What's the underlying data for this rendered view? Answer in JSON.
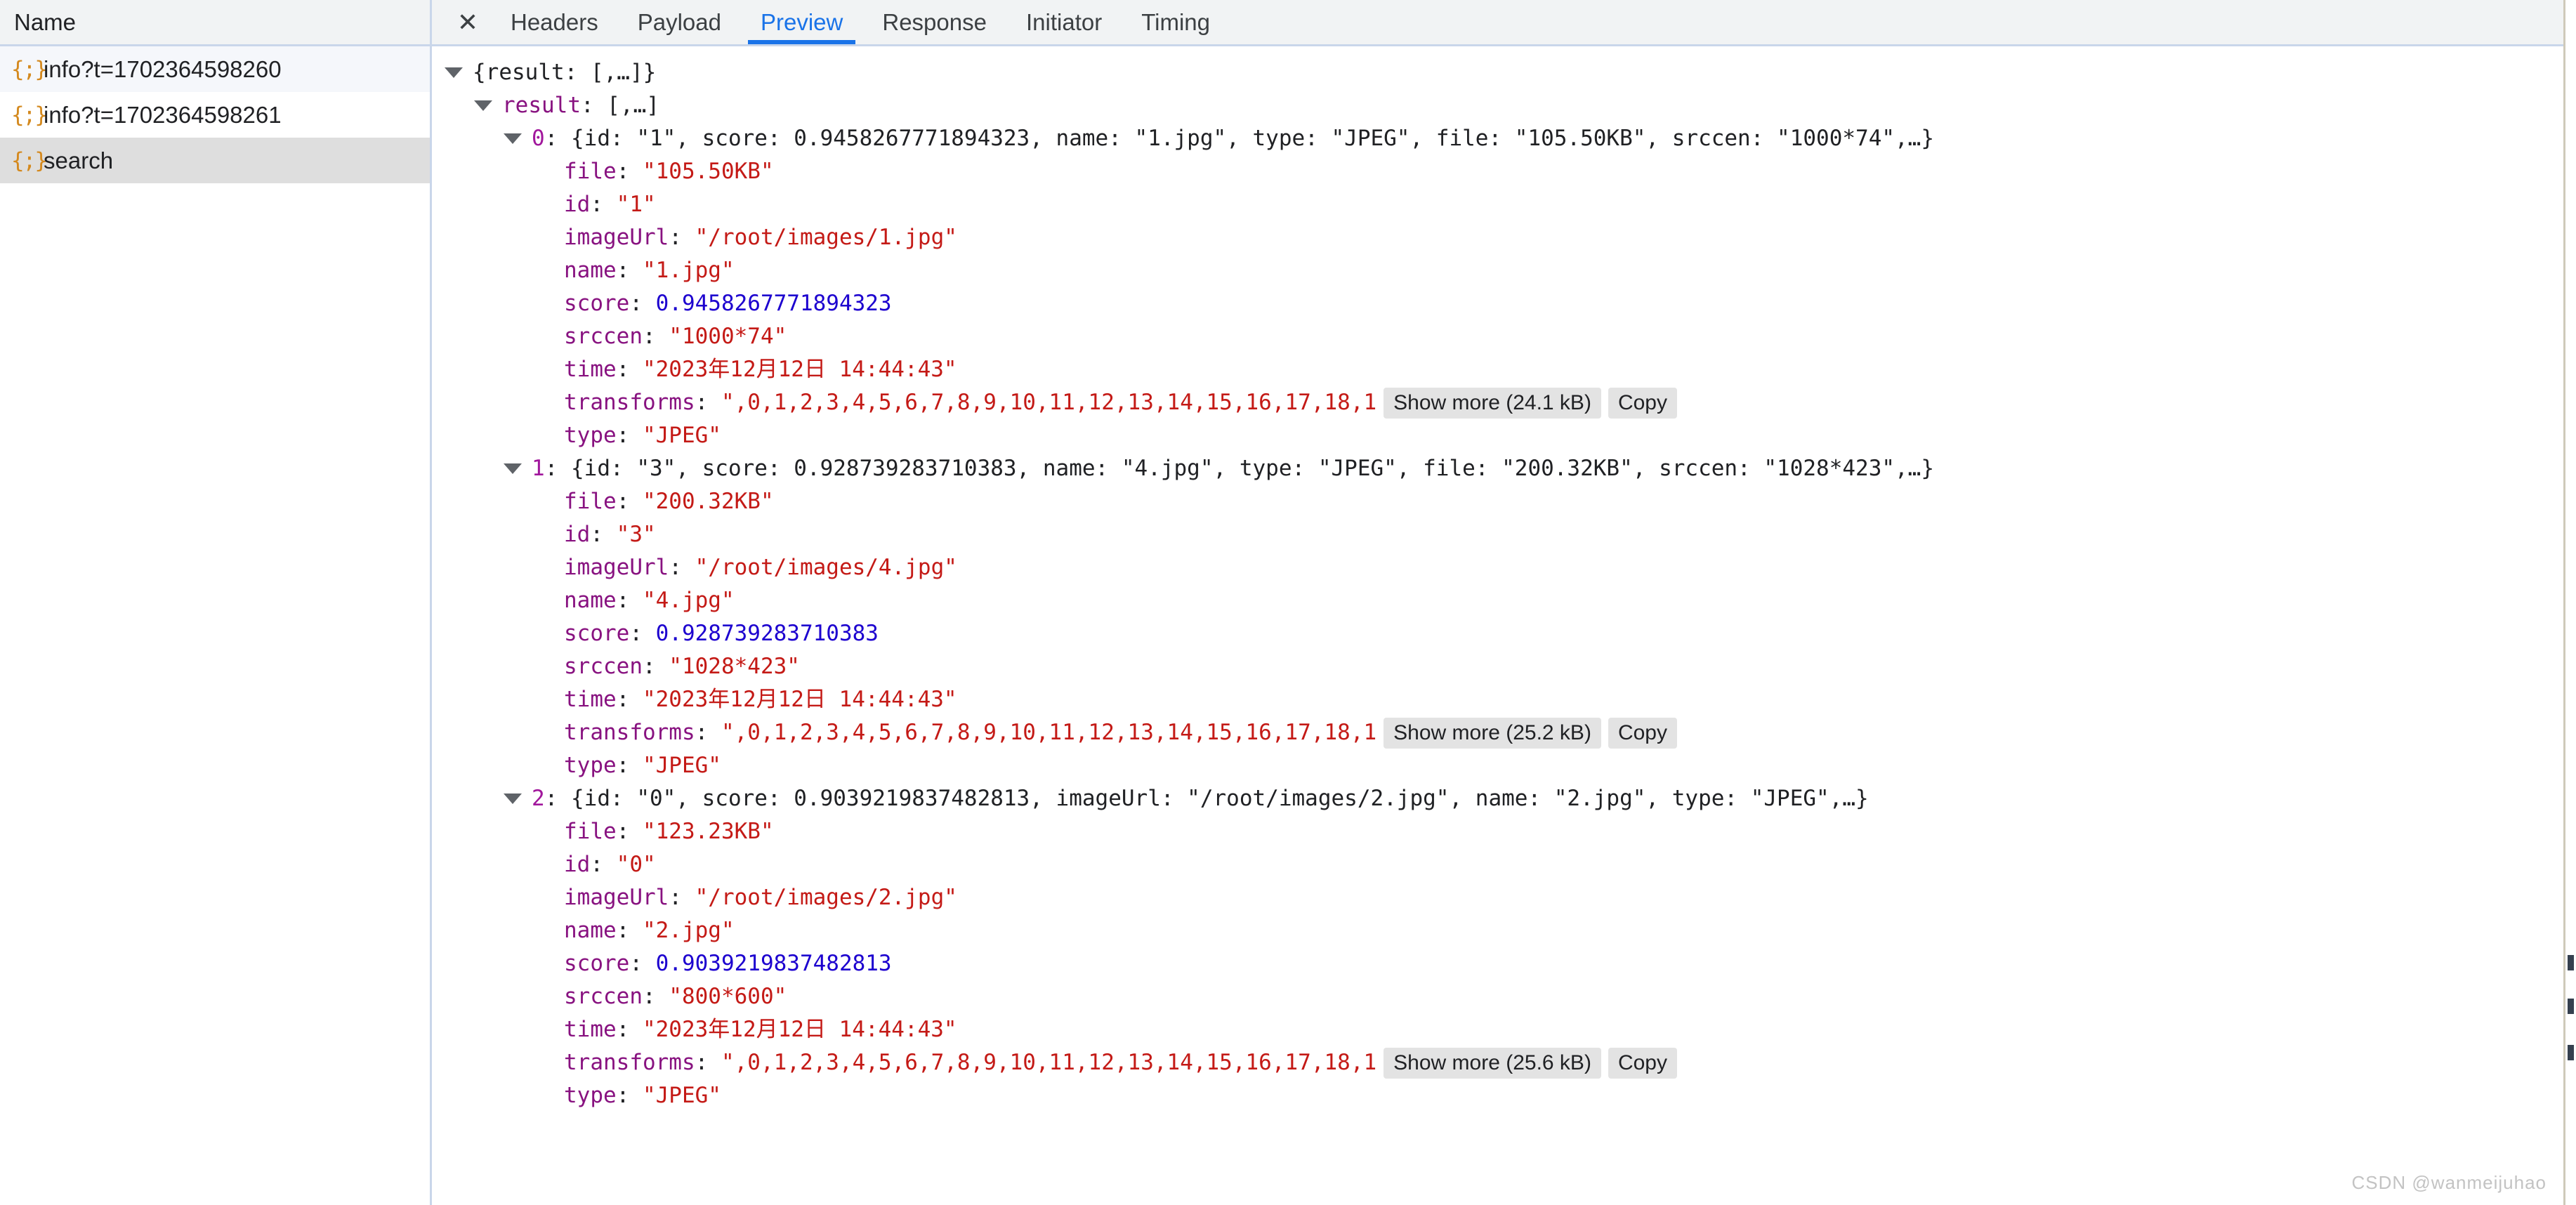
{
  "sidebar": {
    "column_header": "Name",
    "icon_name": "json-braces-icon",
    "requests": [
      {
        "name": "info?t=1702364598260",
        "selected": false
      },
      {
        "name": "info?t=1702364598261",
        "selected": false
      },
      {
        "name": "search",
        "selected": true
      }
    ]
  },
  "tabbar": {
    "close_label": "✕",
    "tabs": [
      {
        "label": "Headers",
        "active": false
      },
      {
        "label": "Payload",
        "active": false
      },
      {
        "label": "Preview",
        "active": true
      },
      {
        "label": "Response",
        "active": false
      },
      {
        "label": "Initiator",
        "active": false
      },
      {
        "label": "Timing",
        "active": false
      }
    ],
    "active_color": "#1a73e8"
  },
  "preview": {
    "root_summary": "{result: [,…]}",
    "result_key": "result",
    "result_summary": ": [,…]",
    "labels": {
      "show_more": "Show more",
      "copy": "Copy"
    },
    "items": [
      {
        "index": "0",
        "summary": ": {id: \"1\", score: 0.9458267771894323, name: \"1.jpg\", type: \"JPEG\", file: \"105.50KB\", srccen: \"1000*74\",…}",
        "props": {
          "file_key": "file",
          "file_value": "\"105.50KB\"",
          "id_key": "id",
          "id_value": "\"1\"",
          "imageUrl_key": "imageUrl",
          "imageUrl_value": "\"/root/images/1.jpg\"",
          "name_key": "name",
          "name_value": "\"1.jpg\"",
          "score_key": "score",
          "score_value": "0.9458267771894323",
          "srccen_key": "srccen",
          "srccen_value": "\"1000*74\"",
          "time_key": "time",
          "time_value": "\"2023年12月12日 14:44:43\"",
          "transforms_key": "transforms",
          "transforms_value": "\",0,1,2,3,4,5,6,7,8,9,10,11,12,13,14,15,16,17,18,1",
          "transforms_show_more": "Show more (24.1 kB)",
          "transforms_copy": "Copy",
          "type_key": "type",
          "type_value": "\"JPEG\""
        }
      },
      {
        "index": "1",
        "summary": ": {id: \"3\", score: 0.928739283710383, name: \"4.jpg\", type: \"JPEG\", file: \"200.32KB\", srccen: \"1028*423\",…}",
        "props": {
          "file_key": "file",
          "file_value": "\"200.32KB\"",
          "id_key": "id",
          "id_value": "\"3\"",
          "imageUrl_key": "imageUrl",
          "imageUrl_value": "\"/root/images/4.jpg\"",
          "name_key": "name",
          "name_value": "\"4.jpg\"",
          "score_key": "score",
          "score_value": "0.928739283710383",
          "srccen_key": "srccen",
          "srccen_value": "\"1028*423\"",
          "time_key": "time",
          "time_value": "\"2023年12月12日 14:44:43\"",
          "transforms_key": "transforms",
          "transforms_value": "\",0,1,2,3,4,5,6,7,8,9,10,11,12,13,14,15,16,17,18,1",
          "transforms_show_more": "Show more (25.2 kB)",
          "transforms_copy": "Copy",
          "type_key": "type",
          "type_value": "\"JPEG\""
        }
      },
      {
        "index": "2",
        "summary": ": {id: \"0\", score: 0.9039219837482813, imageUrl: \"/root/images/2.jpg\", name: \"2.jpg\", type: \"JPEG\",…}",
        "props": {
          "file_key": "file",
          "file_value": "\"123.23KB\"",
          "id_key": "id",
          "id_value": "\"0\"",
          "imageUrl_key": "imageUrl",
          "imageUrl_value": "\"/root/images/2.jpg\"",
          "name_key": "name",
          "name_value": "\"2.jpg\"",
          "score_key": "score",
          "score_value": "0.9039219837482813",
          "srccen_key": "srccen",
          "srccen_value": "\"800*600\"",
          "time_key": "time",
          "time_value": "\"2023年12月12日 14:44:43\"",
          "transforms_key": "transforms",
          "transforms_value": "\",0,1,2,3,4,5,6,7,8,9,10,11,12,13,14,15,16,17,18,1",
          "transforms_show_more": "Show more (25.6 kB)",
          "transforms_copy": "Copy",
          "type_key": "type",
          "type_value": "\"JPEG\""
        }
      }
    ]
  },
  "watermark": "CSDN @wanmeijuhao",
  "colors": {
    "key": "#881280",
    "index": "#a1179c",
    "string": "#c41a16",
    "number": "#1c00cf",
    "accent": "#1a73e8",
    "selected_row": "#dedede"
  }
}
